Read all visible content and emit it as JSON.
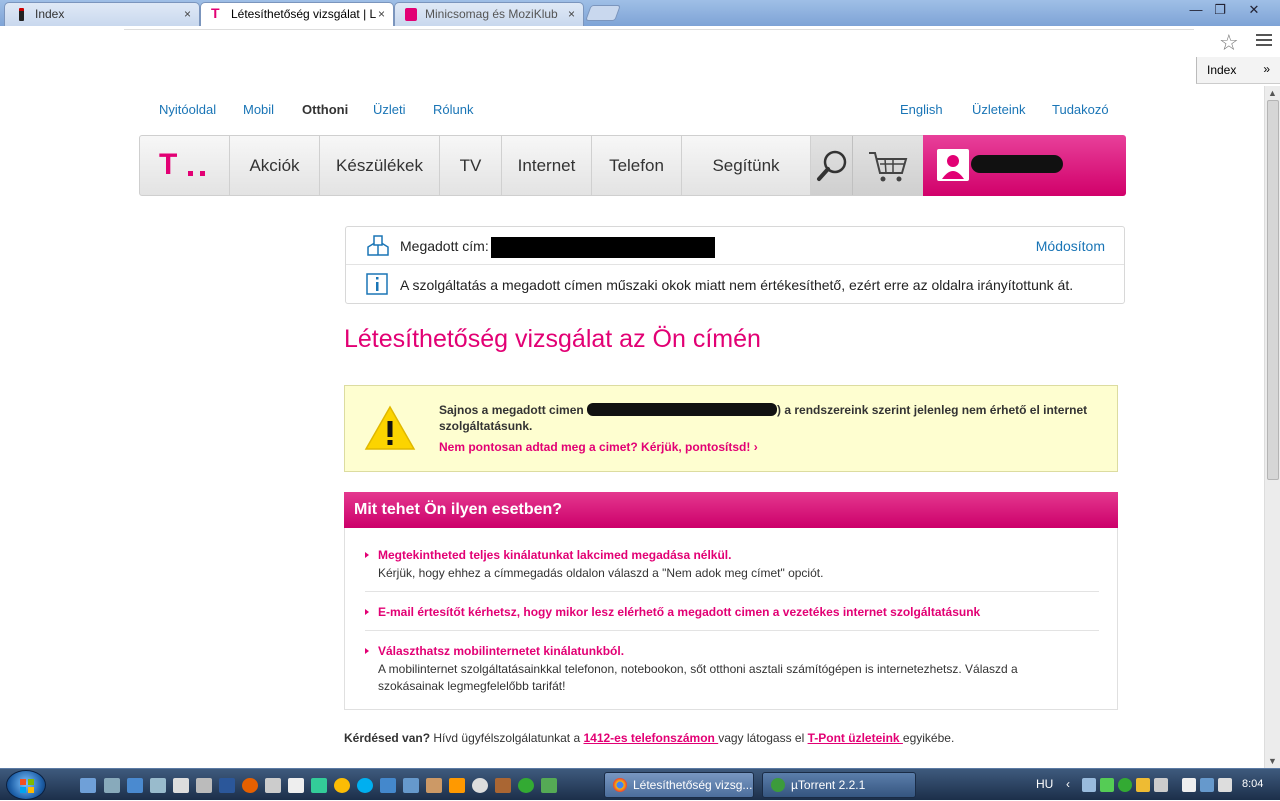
{
  "browser": {
    "tabs": [
      {
        "title": "Index",
        "close": "×"
      },
      {
        "title": "Létesíthetőség vizsgálat | L",
        "close": "×"
      },
      {
        "title": "Minicsomag és MoziKlub",
        "close": "×"
      }
    ],
    "window_controls": {
      "minimize": "—",
      "maximize": "❐",
      "close": "✕"
    },
    "star": "☆",
    "bookmark_folder": "Index",
    "bookmark_more": "»"
  },
  "toplinks": {
    "left": [
      "Nyitóoldal",
      "Mobil",
      "Otthoni",
      "Üzleti",
      "Rólunk"
    ],
    "selected": "Otthoni",
    "right": [
      "English",
      "Üzleteink",
      "Tudakozó"
    ]
  },
  "mainnav": {
    "logo_t": "T",
    "items": [
      "Akciók",
      "Készülékek",
      "TV",
      "Internet",
      "Telefon",
      "Segítünk"
    ],
    "search_icon": "search-icon",
    "cart_icon": "cart-icon"
  },
  "address": {
    "label": "Megadott cím:",
    "modify": "Módosítom",
    "info": "A szolgáltatás a megadott címen műszaki okok miatt nem értékesíthető, ezért erre az oldalra irányítottunk át."
  },
  "page_title": "Létesíthetőség vizsgálat az Ön címén",
  "warning": {
    "text_before": "Sajnos a megadott cimen",
    "text_after": ") a rendszereink szerint jelenleg nem érhető el internet szolgáltatásunk.",
    "link": "Nem pontosan adtad meg a cimet? Kérjük, pontosítsd!",
    "link_arrow": "›"
  },
  "what": {
    "header": "Mit tehet Ön ilyen esetben?",
    "items": [
      {
        "title": "Megtekintheted teljes kinálatunkat lakcimed megadása nélkül.",
        "desc": "Kérjük, hogy ehhez a címmegadás oldalon válaszd a \"Nem adok meg címet\" opciót."
      },
      {
        "title": "E-mail értesítőt kérhetsz, hogy mikor lesz elérhető a megadott cimen a vezetékes internet szolgáltatásunk",
        "desc": ""
      },
      {
        "title": "Választhatsz mobilinternetet kinálatunkból.",
        "desc": "A mobilinternet szolgáltatásainkkal telefonon, notebookon, sőt otthoni asztali számítógépen is internetezhetsz. Válaszd a szokásainak legmegfelelőbb tarifát!"
      }
    ]
  },
  "question": {
    "bold": "Kérdésed van?",
    "text1": " Hívd ügyfélszolgálatunkat a ",
    "link1": "1412-es telefonszámon ",
    "text2": "vagy látogass el ",
    "link2": "T-Pont üzleteink ",
    "text3": "egyikébe."
  },
  "taskbar": {
    "tasks": [
      "Létesíthetőség vizsg...",
      "µTorrent 2.2.1"
    ],
    "lang": "HU",
    "tray_arrow": "‹",
    "clock": "8:04"
  },
  "colors": {
    "brand": "#e20074",
    "link": "#1a75b6"
  }
}
